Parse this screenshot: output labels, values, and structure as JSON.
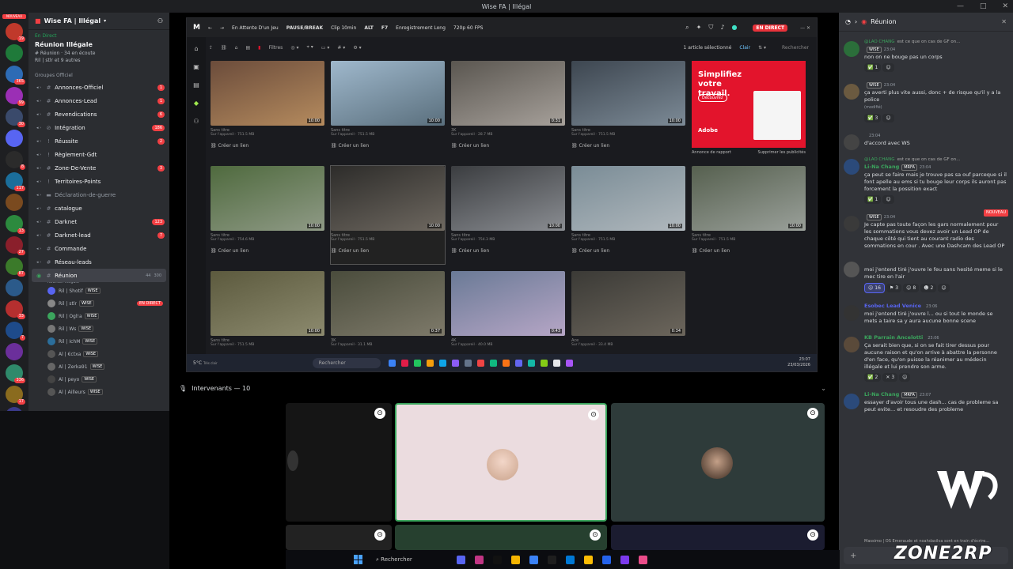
{
  "window": {
    "title": "Wise FA | Illégal",
    "controls": [
      "—",
      "□",
      "✕"
    ]
  },
  "servers": {
    "new_badge": "NOUVEAU",
    "items": [
      {
        "color": "#c0392b",
        "badge": "19"
      },
      {
        "color": "#1f7a3a",
        "badge": ""
      },
      {
        "color": "#2d6bb5",
        "badge": "365"
      },
      {
        "color": "#9b2fb5",
        "badge": "99"
      },
      {
        "color": "#3a4a6b",
        "badge": "30"
      },
      {
        "color": "#5865f2",
        "badge": ""
      },
      {
        "color": "#2b2b2b",
        "badge": "8"
      },
      {
        "color": "#1b6e9b",
        "badge": "117"
      },
      {
        "color": "#7a4a1f",
        "badge": ""
      },
      {
        "color": "#2c8a3e",
        "badge": "13"
      },
      {
        "color": "#8a1f2b",
        "badge": "27"
      },
      {
        "color": "#3b7a2a",
        "badge": "87"
      },
      {
        "color": "#2b5a8a",
        "badge": ""
      },
      {
        "color": "#b52f2f",
        "badge": "33"
      },
      {
        "color": "#1e4b8a",
        "badge": "7"
      },
      {
        "color": "#6b2f9b",
        "badge": ""
      },
      {
        "color": "#2f8a6b",
        "badge": "336"
      },
      {
        "color": "#8a6b1e",
        "badge": "17"
      },
      {
        "color": "#3a3a8a",
        "badge": ""
      }
    ]
  },
  "sidebar": {
    "server_name": "Wise FA | Illégal",
    "voice_status": "En Direct",
    "voice_title": "Réunion Illégale",
    "voice_sub": "# Réunion  ·  34 en écoute",
    "voice_people": "Ril | stlr et 9 autres",
    "category": "Groupes Officiel",
    "channels": [
      {
        "icon": "#",
        "name": "Annonces-Officiel",
        "badge": "1",
        "bold": true
      },
      {
        "icon": "#",
        "name": "Annonces-Lead",
        "badge": "1",
        "bold": true
      },
      {
        "icon": "#",
        "name": "Revendications",
        "badge": "6",
        "bold": true
      },
      {
        "icon": "⊘",
        "name": "Intégration",
        "badge": "186",
        "bold": true
      },
      {
        "icon": "!",
        "name": "Réussite",
        "badge": "2",
        "bold": true
      },
      {
        "icon": "!",
        "name": "Règlement-Gdt",
        "badge": "",
        "bold": true
      },
      {
        "icon": "#",
        "name": "Zone-De-Vente",
        "badge": "3",
        "bold": true
      },
      {
        "icon": "!",
        "name": "Territoires-Points",
        "badge": "",
        "bold": true
      },
      {
        "icon": "▬",
        "name": "Déclaration-de-guerre",
        "badge": "",
        "bold": false
      },
      {
        "icon": "#",
        "name": "catalogue",
        "badge": "",
        "bold": true
      },
      {
        "icon": "#",
        "name": "Darknet",
        "badge": "123",
        "bold": true
      },
      {
        "icon": "#",
        "name": "Darknet-lead",
        "badge": "7",
        "bold": true
      },
      {
        "icon": "#",
        "name": "Commande",
        "badge": "",
        "bold": true
      },
      {
        "icon": "#",
        "name": "Réseau-leads",
        "badge": "",
        "bold": true
      }
    ],
    "active_channel": {
      "name": "Réunion",
      "sub": "Réunion Illégale",
      "count": "44",
      "limit": "300"
    },
    "members": [
      {
        "name": "Ril | Shotif",
        "tag": "WISE",
        "live": ""
      },
      {
        "name": "Ril | stlr",
        "tag": "WISE",
        "live": "EN DIRECT"
      },
      {
        "name": "Ril | Ogl!a",
        "tag": "WISE",
        "live": ""
      },
      {
        "name": "Ril | Ws",
        "tag": "WISE",
        "live": ""
      },
      {
        "name": "Ril | IchM",
        "tag": "WISE",
        "live": ""
      },
      {
        "name": "Al | €ctxa",
        "tag": "WISE",
        "live": ""
      },
      {
        "name": "Al | Zerka91",
        "tag": "WISE",
        "live": ""
      },
      {
        "name": "Al | peyo",
        "tag": "WISE",
        "live": ""
      },
      {
        "name": "Al | Ailleurs",
        "tag": "WISE",
        "live": ""
      }
    ]
  },
  "medal": {
    "topbar": [
      "En Attente D'un Jeu",
      "PAUSE/BREAK",
      "Clip 10min",
      "ALT",
      "F7",
      "Enregistrement Long",
      "720p 60 FPS"
    ],
    "live_badge": "EN DIRECT",
    "filters": "Filtres",
    "selected": "1 article sélectionné",
    "theme": "Clair",
    "search_placeholder": "Rechercher",
    "cards": [
      {
        "dur": "10:00",
        "title": "Sans titre",
        "meta": "Sur l'appareil · 751.5 MB",
        "link": "Créer un lien",
        "colors": [
          "#6b4c3b",
          "#b58b5e"
        ]
      },
      {
        "dur": "10:00",
        "title": "Sans titre",
        "meta": "Sur l'appareil · 751.5 MB",
        "link": "Créer un lien",
        "colors": [
          "#9fb8cc",
          "#5a6f7d"
        ]
      },
      {
        "dur": "0:31",
        "title": "3K",
        "meta": "Sur l'appareil · 28.7 MB",
        "link": "Créer un lien",
        "colors": [
          "#5a5650",
          "#a6a09a"
        ]
      },
      {
        "dur": "10:00",
        "title": "Sans titre",
        "meta": "Sur l'appareil · 751.5 MB",
        "link": "Créer un lien",
        "colors": [
          "#3d4650",
          "#7c8a96"
        ]
      },
      {
        "dur": "",
        "title": "Annonce de rapport",
        "meta": "Supprimer les publicités",
        "link": "",
        "colors": [
          "#e3142c",
          "#e3142c"
        ]
      },
      {
        "dur": "10:00",
        "title": "Sans titre",
        "meta": "Sur l'appareil · 754.6 MB",
        "link": "Créer un lien",
        "colors": [
          "#4f6a3e",
          "#8f9a86"
        ]
      },
      {
        "dur": "10:00",
        "title": "Sans titre",
        "meta": "Sur l'appareil · 751.5 MB",
        "link": "Créer un lien",
        "colors": [
          "#2d2c2a",
          "#6e6860"
        ]
      },
      {
        "dur": "10:00",
        "title": "Sans titre",
        "meta": "Sur l'appareil · 754.3 MB",
        "link": "Créer un lien",
        "colors": [
          "#3b3d40",
          "#8a8d92"
        ]
      },
      {
        "dur": "10:00",
        "title": "Sans titre",
        "meta": "Sur l'appareil · 751.5 MB",
        "link": "Créer un lien",
        "colors": [
          "#7a8c96",
          "#b0b8bd"
        ]
      },
      {
        "dur": "10:00",
        "title": "Sans titre",
        "meta": "Sur l'appareil · 751.5 MB",
        "link": "Créer un lien",
        "colors": [
          "#56604f",
          "#9aa09a"
        ]
      },
      {
        "dur": "10:00",
        "title": "Sans titre",
        "meta": "Sur l'appareil · 751.5 MB",
        "link": "",
        "colors": [
          "#5c5a3e",
          "#8c8a6e"
        ]
      },
      {
        "dur": "0:37",
        "title": "3K",
        "meta": "Sur l'appareil · 31.1 MB",
        "link": "",
        "colors": [
          "#4a4c3c",
          "#7e7a6a"
        ]
      },
      {
        "dur": "0:43",
        "title": "4K",
        "meta": "Sur l'appareil · 40.0 MB",
        "link": "",
        "colors": [
          "#6a7a96",
          "#b6a6c6"
        ]
      },
      {
        "dur": "0:34",
        "title": "Ace",
        "meta": "Sur l'appareil · 33.4 MB",
        "link": "",
        "colors": [
          "#3b3a36",
          "#6c665c"
        ]
      },
      {
        "dur": "",
        "title": "",
        "meta": "",
        "link": "",
        "colors": [
          "#1a1b1f",
          "#1a1b1f"
        ]
      }
    ],
    "ad": {
      "headline": "Simplifiez votre travail.",
      "button": "Découvrez",
      "brand": "Adobe",
      "footer_left": "Annonce de rapport",
      "footer_right": "Supprimer les publicités"
    },
    "inner_task": {
      "weather": "5°C",
      "weather_sub": "Très clair",
      "search": "Rechercher",
      "time": "23:07",
      "date": "23/03/2026"
    }
  },
  "speakers": {
    "label": "Intervenants — 10"
  },
  "chat": {
    "channel": "Réunion",
    "messages": [
      {
        "reply": "@LAO CHANG",
        "reply_text": "est ce que on cas de GF on...",
        "name": "",
        "tag": "WISE",
        "time": "23:04",
        "text": "non on ne bouge pas un corps",
        "reactions": [
          {
            "e": "✅",
            "n": "1"
          },
          {
            "e": "☺",
            "n": ""
          }
        ],
        "av": "#2b6e3a",
        "namecolor": "#f23f43"
      },
      {
        "reply": "",
        "reply_text": "",
        "name": "",
        "tag": "WISE",
        "time": "23:04",
        "text": "ça averti plus vite aussi, donc + de risque qu'il y a la police",
        "edited": "(modifié)",
        "reactions": [
          {
            "e": "✅",
            "n": "3"
          },
          {
            "e": "☺",
            "n": ""
          }
        ],
        "av": "#6b5a40",
        "namecolor": "#9b59b6"
      },
      {
        "reply": "",
        "reply_text": "",
        "name": "",
        "tag": "",
        "time": "23:04",
        "text": "d'accord avec WS",
        "reactions": [],
        "av": "#444",
        "namecolor": "#dbdee1"
      },
      {
        "reply": "@LAO CHANG",
        "reply_text": "est ce que on cas de GF on...",
        "name": "Li-Na Chang",
        "tag": "MRFA",
        "time": "23:04",
        "text": "ça peut se faire mais je trouve pas sa ouf parceque si il font apelle au ems si tu bouge leur corps ils auront pas forcement la possition exact",
        "reactions": [
          {
            "e": "✅",
            "n": "1"
          },
          {
            "e": "☺",
            "n": ""
          }
        ],
        "av": "#2b4a7a",
        "namecolor": "#3ba55d"
      },
      {
        "reply": "",
        "reply_text": "",
        "name": "",
        "tag": "WISE",
        "time": "23:04",
        "text": "Je capte pas toute façon les gars normalement pour les sommations vous devez avoir un Lead OP de chaque côté qui tient au courant radio des sommations en cour . Avec une Dashcam des Lead OP",
        "reactions": [],
        "av": "#3a3a3a",
        "namecolor": "#f23f43",
        "new": "NOUVEAU"
      },
      {
        "reply": "",
        "reply_text": "",
        "name": "",
        "tag": "",
        "time": "",
        "text": "moi j'entend tiré j'ouvre le feu sans hesité meme si le mec tire en l'air",
        "reactions": [
          {
            "e": "☹",
            "n": "16"
          },
          {
            "e": "⚑",
            "n": "3"
          },
          {
            "e": "☺",
            "n": "8"
          },
          {
            "e": "☻",
            "n": "2"
          },
          {
            "e": "☺",
            "n": ""
          }
        ],
        "av": "#555",
        "namecolor": "#dbdee1"
      },
      {
        "reply": "",
        "reply_text": "",
        "name": "Esobec Lead Venice",
        "tag": "",
        "time": "23:06",
        "text": "moi j'entend tiré j'ouvre l... ou si tout le monde se mets a taire sa y aura aucune bonne scene",
        "reactions": [],
        "av": "#333",
        "namecolor": "#5865f2"
      },
      {
        "reply": "",
        "reply_text": "",
        "name": "KB Parrain Ancelotti",
        "tag": "",
        "time": "23:06",
        "text": "Ça serait bien que, si on se fait tirer dessus pour aucune raison et qu'on arrive à abattre la personne d'en face, qu'on puisse la réanimer au médecin illégale et lui prendre son arme.",
        "reactions": [
          {
            "e": "✅",
            "n": "2"
          },
          {
            "e": "✕",
            "n": "3"
          },
          {
            "e": "☺",
            "n": ""
          }
        ],
        "av": "#5a4a3a",
        "namecolor": "#3ba55d"
      },
      {
        "reply": "",
        "reply_text": "",
        "name": "Li-Na Chang",
        "tag": "MRFA",
        "time": "23:07",
        "text": "essayer d'avoir tous une dash... cas de probleme sa peut evite... et resoudre des probleme",
        "reactions": [],
        "av": "#2b4a7a",
        "namecolor": "#3ba55d"
      }
    ],
    "typing": "Massimo | OS Emeraude et noahdasilva sont en train d'écrire...",
    "input_plus": "+"
  },
  "taskbar": {
    "search": "Rechercher",
    "apps": [
      "#5865f2",
      "#c13584",
      "#111",
      "#f4b400",
      "#3b82f6",
      "#1e1e1e",
      "#0078d4",
      "#fbbc05",
      "#2563eb",
      "#7c3aed",
      "#ea4c89"
    ]
  },
  "watermark": {
    "brand": "ZONE2RP"
  }
}
